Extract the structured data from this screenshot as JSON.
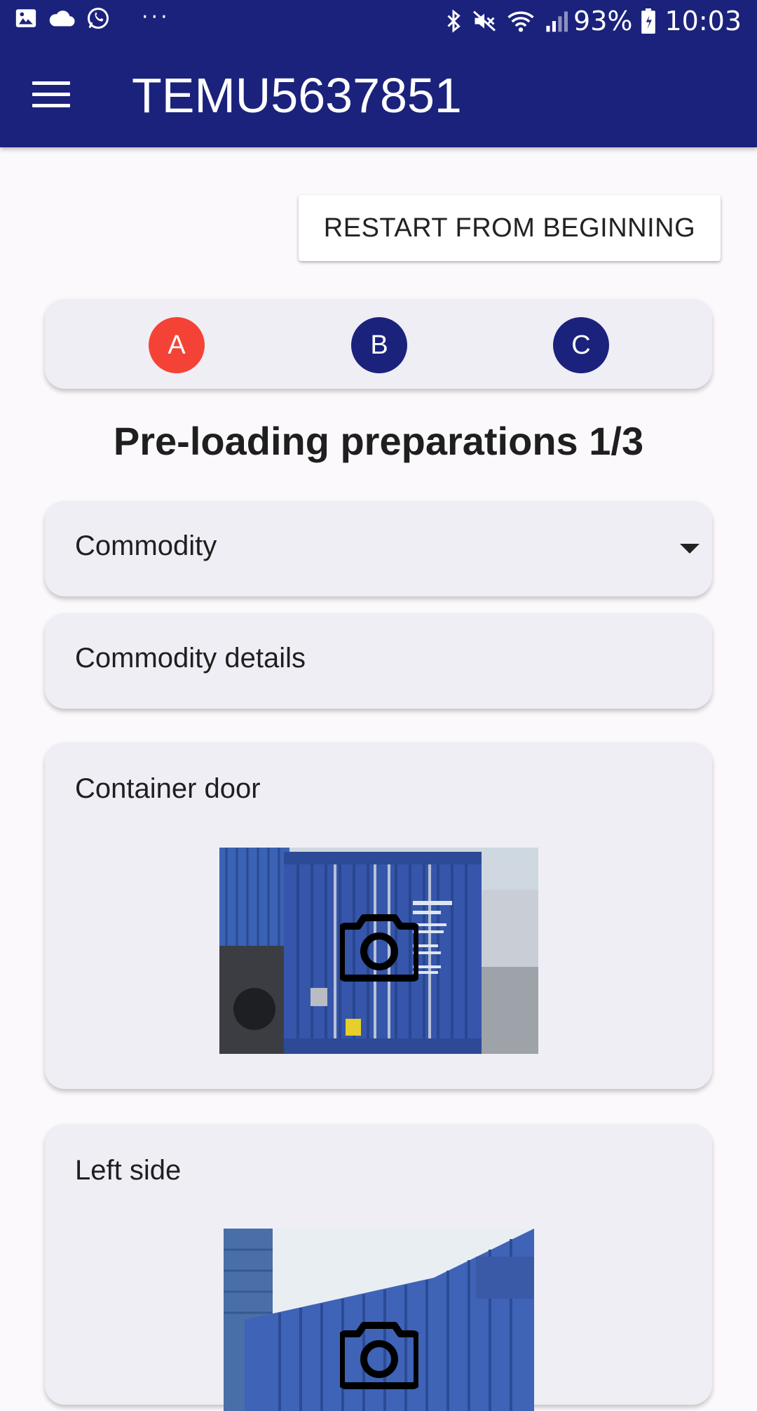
{
  "status_bar": {
    "battery": "93%",
    "time": "10:03",
    "more": "···"
  },
  "app_bar": {
    "title": "TEMU5637851"
  },
  "actions": {
    "restart_label": "RESTART FROM BEGINNING"
  },
  "stepper": {
    "steps": [
      {
        "label": "A",
        "color": "#f44336"
      },
      {
        "label": "B",
        "color": "#1b227c"
      },
      {
        "label": "C",
        "color": "#1b227c"
      }
    ]
  },
  "section": {
    "title": "Pre-loading preparations 1/3"
  },
  "form": {
    "commodity_label": "Commodity",
    "commodity_details_label": "Commodity details"
  },
  "photos": [
    {
      "label": "Container door",
      "icon": "camera-icon"
    },
    {
      "label": "Left side",
      "icon": "camera-icon"
    }
  ],
  "colors": {
    "primary": "#1b227c",
    "active_step": "#f44336",
    "card_bg": "#efeef5"
  }
}
